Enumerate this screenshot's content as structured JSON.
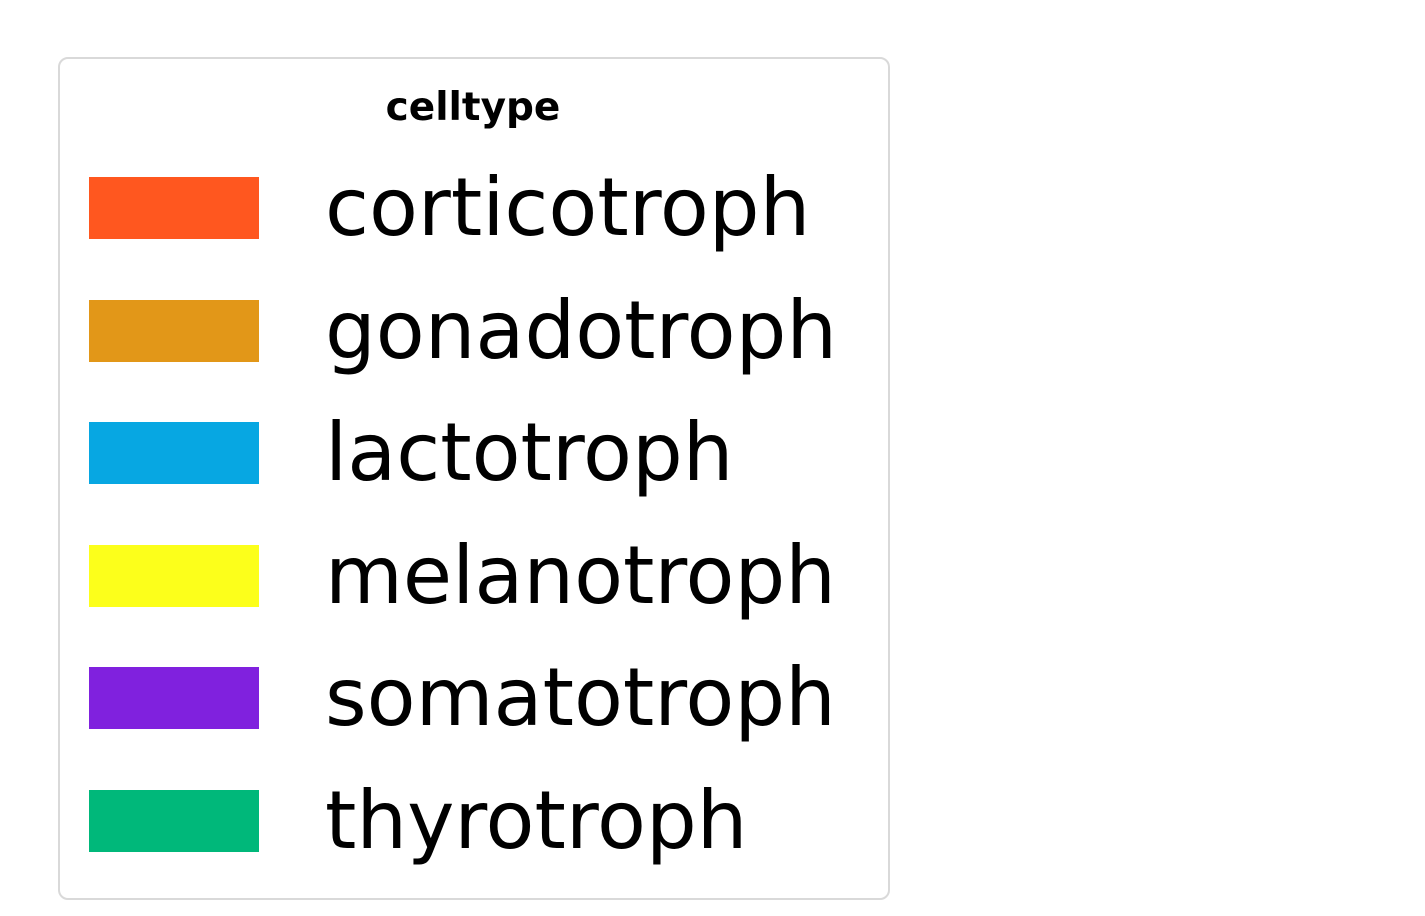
{
  "chart_data": {
    "type": "legend",
    "legend_title": "celltype",
    "entries": [
      {
        "label": "corticotroph",
        "color": "#ff571f"
      },
      {
        "label": "gonadotroph",
        "color": "#e29718"
      },
      {
        "label": "lactotroph",
        "color": "#07a7e2"
      },
      {
        "label": "melanotroph",
        "color": "#fcff1b"
      },
      {
        "label": "somatotroph",
        "color": "#8021de"
      },
      {
        "label": "thyrotroph",
        "color": "#00b87a"
      }
    ],
    "legend_placement": "top-left",
    "frame_color": "#d9d9d9"
  }
}
